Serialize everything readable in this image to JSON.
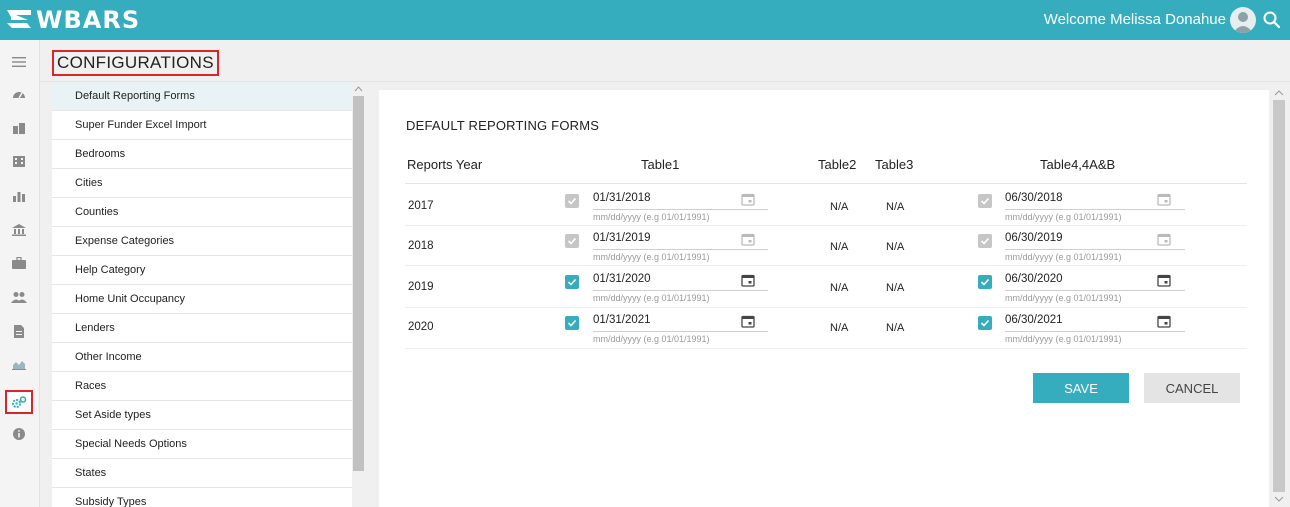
{
  "app": {
    "name": "WBARS",
    "welcome": "Welcome Melissa Donahue"
  },
  "icons": {
    "rail": [
      "menu-icon",
      "dashboard-icon",
      "people-icon",
      "building-icon",
      "chart-icon",
      "bank-icon",
      "briefcase-icon",
      "users-icon",
      "document-icon",
      "area-chart-icon",
      "settings-icon",
      "info-icon"
    ],
    "active_rail": "settings-icon"
  },
  "page": {
    "title": "CONFIGURATIONS"
  },
  "menu": {
    "items": [
      "Default Reporting Forms",
      "Super Funder Excel Import",
      "Bedrooms",
      "Cities",
      "Counties",
      "Expense Categories",
      "Help Category",
      "Home Unit Occupancy",
      "Lenders",
      "Other Income",
      "Races",
      "Set Aside types",
      "Special Needs Options",
      "States",
      "Subsidy Types"
    ],
    "active": "Default Reporting Forms"
  },
  "form": {
    "title": "DEFAULT REPORTING FORMS",
    "columns": {
      "year": "Reports Year",
      "table1": "Table1",
      "table2": "Table2",
      "table3": "Table3",
      "table4": "Table4,4A&B"
    },
    "hint": "mm/dd/yyyy (e.g 01/01/1991)",
    "rows": [
      {
        "year": "2017",
        "t1_checked": false,
        "t1_date": "01/31/2018",
        "t2": "N/A",
        "t3": "N/A",
        "t4_checked": false,
        "t4_date": "06/30/2018"
      },
      {
        "year": "2018",
        "t1_checked": false,
        "t1_date": "01/31/2019",
        "t2": "N/A",
        "t3": "N/A",
        "t4_checked": false,
        "t4_date": "06/30/2019"
      },
      {
        "year": "2019",
        "t1_checked": true,
        "t1_date": "01/31/2020",
        "t2": "N/A",
        "t3": "N/A",
        "t4_checked": true,
        "t4_date": "06/30/2020"
      },
      {
        "year": "2020",
        "t1_checked": true,
        "t1_date": "01/31/2021",
        "t2": "N/A",
        "t3": "N/A",
        "t4_checked": true,
        "t4_date": "06/30/2021"
      }
    ],
    "save_label": "SAVE",
    "cancel_label": "CANCEL"
  },
  "colors": {
    "accent": "#35adbf",
    "highlight_box": "#d9262c",
    "disabled_check": "#c6c6c6"
  }
}
